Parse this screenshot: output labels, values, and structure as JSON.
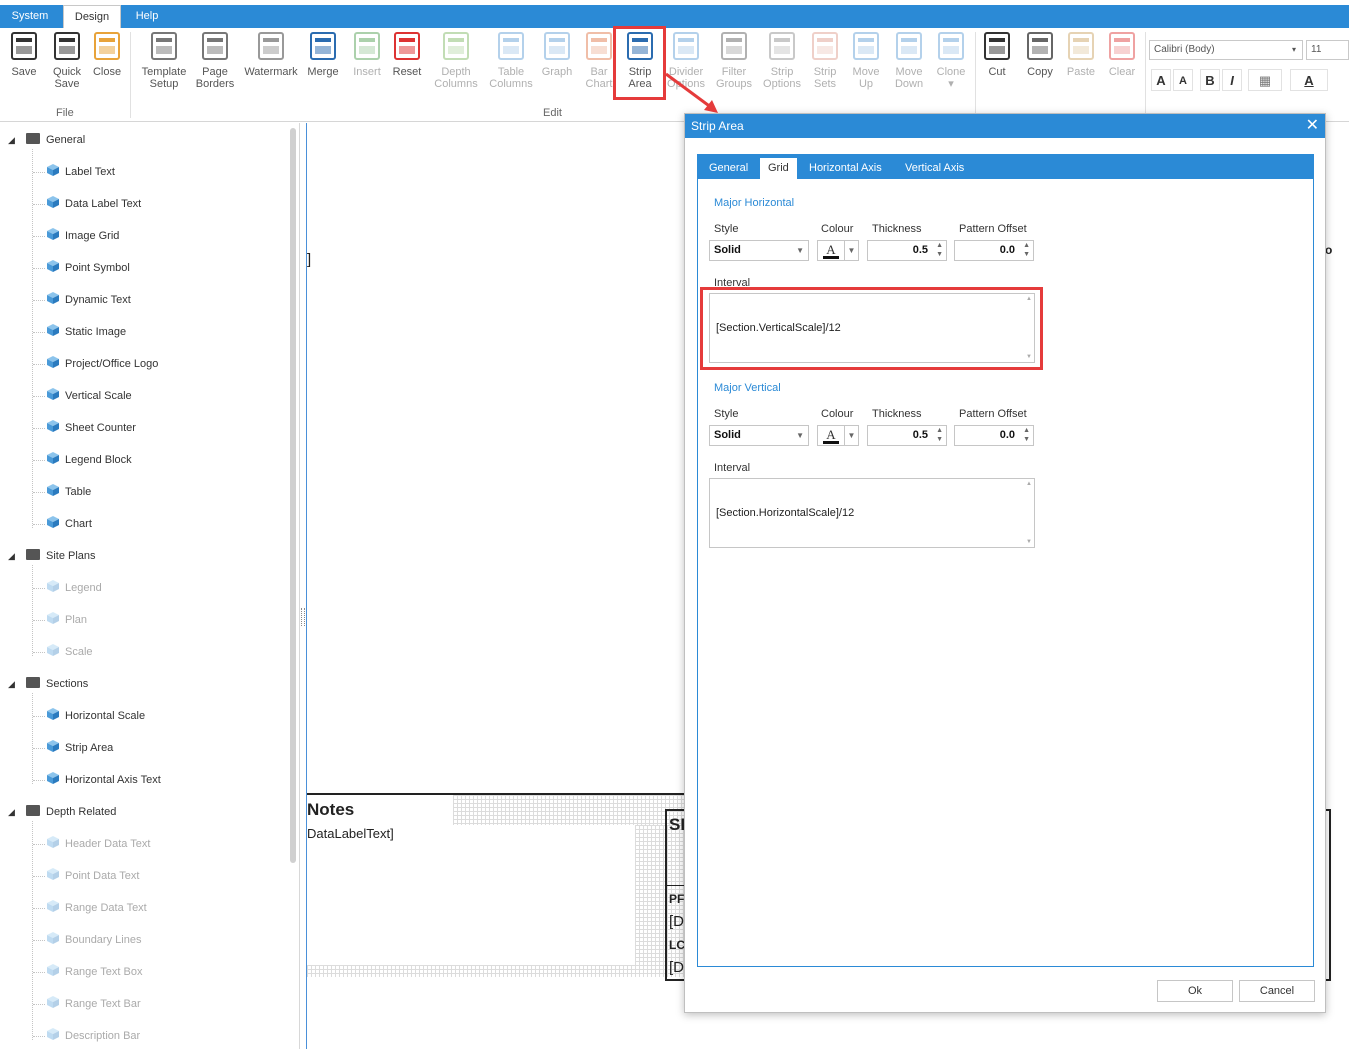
{
  "menu": {
    "tabs": [
      "System",
      "Design",
      "Help"
    ],
    "active": "Design"
  },
  "ribbon": {
    "file_group": "File",
    "edit_group": "Edit",
    "buttons": [
      {
        "l1": "Save",
        "l2": "",
        "icon": "save-icon"
      },
      {
        "l1": "Quick",
        "l2": "Save",
        "icon": "quick-save-icon"
      },
      {
        "l1": "Close",
        "l2": "",
        "icon": "close-file-icon"
      },
      {
        "l1": "Template",
        "l2": "Setup",
        "icon": "gear-page-icon"
      },
      {
        "l1": "Page",
        "l2": "Borders",
        "icon": "page-icon"
      },
      {
        "l1": "Watermark",
        "l2": "",
        "icon": "watermark-icon"
      },
      {
        "l1": "Merge",
        "l2": "",
        "icon": "merge-grid-icon"
      },
      {
        "l1": "Insert",
        "l2": "",
        "icon": "insert-icon"
      },
      {
        "l1": "Reset",
        "l2": "",
        "icon": "reset-icon"
      },
      {
        "l1": "Depth",
        "l2": "Columns",
        "icon": "depth-columns-icon"
      },
      {
        "l1": "Table",
        "l2": "Columns",
        "icon": "table-columns-icon"
      },
      {
        "l1": "Graph",
        "l2": "",
        "icon": "graph-icon"
      },
      {
        "l1": "Bar",
        "l2": "Chart",
        "icon": "bar-chart-icon"
      },
      {
        "l1": "Strip",
        "l2": "Area",
        "icon": "strip-area-icon"
      },
      {
        "l1": "Divider",
        "l2": "Options",
        "icon": "divider-icon"
      },
      {
        "l1": "Filter",
        "l2": "Groups",
        "icon": "filter-icon"
      },
      {
        "l1": "Strip",
        "l2": "Options",
        "icon": "strip-options-icon"
      },
      {
        "l1": "Strip",
        "l2": "Sets",
        "icon": "strip-sets-icon"
      },
      {
        "l1": "Move",
        "l2": "Up",
        "icon": "move-up-icon"
      },
      {
        "l1": "Move",
        "l2": "Down",
        "icon": "move-down-icon"
      },
      {
        "l1": "Clone",
        "l2": "▾",
        "icon": "clone-icon"
      },
      {
        "l1": "Cut",
        "l2": "",
        "icon": "scissors-icon"
      },
      {
        "l1": "Copy",
        "l2": "",
        "icon": "copy-icon"
      },
      {
        "l1": "Paste",
        "l2": "",
        "icon": "paste-icon"
      },
      {
        "l1": "Clear",
        "l2": "",
        "icon": "clear-icon"
      }
    ],
    "font_name": "Calibri (Body)",
    "font_size": "11",
    "fmt": [
      "A",
      "A",
      "B",
      "I",
      "▦",
      "A"
    ]
  },
  "tree": {
    "groups": [
      {
        "label": "General",
        "items": [
          {
            "label": "Label Text",
            "enabled": true
          },
          {
            "label": "Data Label Text",
            "enabled": true
          },
          {
            "label": "Image Grid",
            "enabled": true
          },
          {
            "label": "Point Symbol",
            "enabled": true
          },
          {
            "label": "Dynamic Text",
            "enabled": true
          },
          {
            "label": "Static Image",
            "enabled": true
          },
          {
            "label": "Project/Office Logo",
            "enabled": true
          },
          {
            "label": "Vertical Scale",
            "enabled": true
          },
          {
            "label": "Sheet Counter",
            "enabled": true
          },
          {
            "label": "Legend Block",
            "enabled": true
          },
          {
            "label": "Table",
            "enabled": true
          },
          {
            "label": "Chart",
            "enabled": true
          }
        ]
      },
      {
        "label": "Site Plans",
        "items": [
          {
            "label": "Legend",
            "enabled": false
          },
          {
            "label": "Plan",
            "enabled": false
          },
          {
            "label": "Scale",
            "enabled": false
          }
        ]
      },
      {
        "label": "Sections",
        "items": [
          {
            "label": "Horizontal Scale",
            "enabled": true
          },
          {
            "label": "Strip Area",
            "enabled": true
          },
          {
            "label": "Horizontal Axis Text",
            "enabled": true
          }
        ]
      },
      {
        "label": "Depth Related",
        "items": [
          {
            "label": "Header Data Text",
            "enabled": false
          },
          {
            "label": "Point Data Text",
            "enabled": false
          },
          {
            "label": "Range Data Text",
            "enabled": false
          },
          {
            "label": "Boundary Lines",
            "enabled": false
          },
          {
            "label": "Range Text Box",
            "enabled": false
          },
          {
            "label": "Range Text Bar",
            "enabled": false
          },
          {
            "label": "Description Bar",
            "enabled": false
          }
        ]
      }
    ]
  },
  "canvas": {
    "bracket": "]",
    "notes_title": "Notes",
    "notes_text": "DataLabelText]",
    "frag_s": "SI",
    "frag_pr": "PF",
    "frag_d1": "[D",
    "frag_lo": "LC",
    "frag_d2": "[D",
    "frag_edge": "o"
  },
  "dialog": {
    "title": "Strip Area",
    "tabs": [
      "General",
      "Grid",
      "Horizontal Axis",
      "Vertical Axis"
    ],
    "active_tab": "Grid",
    "labels": {
      "style": "Style",
      "colour": "Colour",
      "thickness": "Thickness",
      "offset": "Pattern Offset",
      "interval": "Interval"
    },
    "major_horizontal": {
      "title": "Major Horizontal",
      "style": "Solid",
      "colour_glyph": "A",
      "colour": "#111111",
      "thickness": "0.5",
      "offset": "0.0",
      "interval": "[Section.VerticalScale]/12"
    },
    "major_vertical": {
      "title": "Major Vertical",
      "style": "Solid",
      "colour_glyph": "A",
      "colour": "#111111",
      "thickness": "0.5",
      "offset": "0.0",
      "interval": "[Section.HorizontalScale]/12"
    },
    "ok": "Ok",
    "cancel": "Cancel"
  },
  "colors": {
    "accent": "#2b8ad6",
    "highlight": "#e53b3b"
  }
}
